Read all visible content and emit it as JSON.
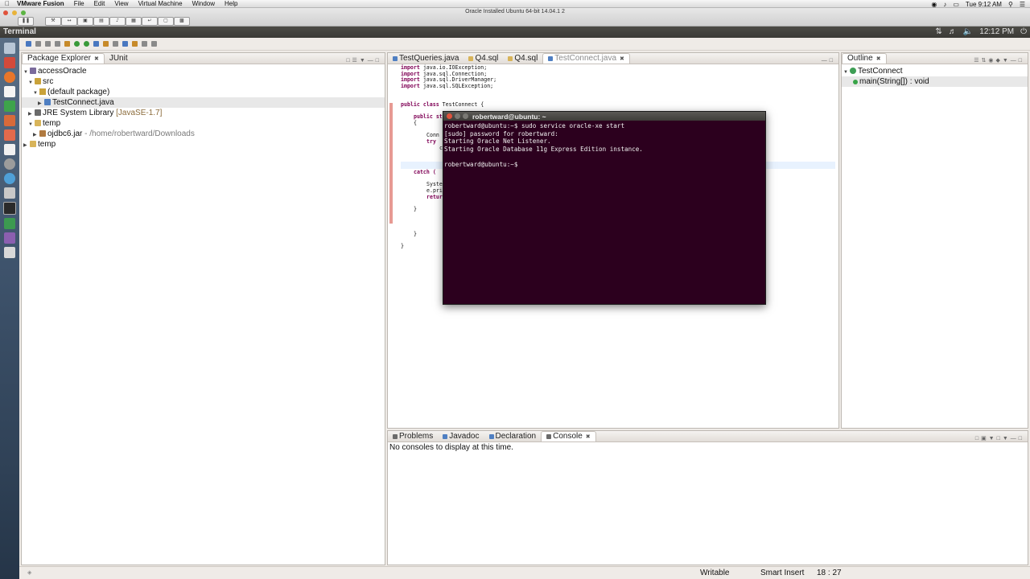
{
  "mac_menu": {
    "app": "VMware Fusion",
    "items": [
      "File",
      "Edit",
      "View",
      "Virtual Machine",
      "Window",
      "Help"
    ],
    "clock": "Tue 9:12 AM"
  },
  "vmware": {
    "window_title": "Oracle Installed Ubuntu 64-bit 14.04.1 2"
  },
  "ubuntu_panel": {
    "title": "Terminal",
    "clock": "12:12 PM"
  },
  "package_explorer": {
    "tabs": [
      {
        "label": "Package Explorer"
      },
      {
        "label": "JUnit"
      }
    ],
    "tree": [
      {
        "label": "accessOracle"
      },
      {
        "label": "src"
      },
      {
        "label": "(default package)"
      },
      {
        "label": "TestConnect.java"
      },
      {
        "label": "JRE System Library",
        "extra": "[JavaSE-1.7]"
      },
      {
        "label": "temp"
      },
      {
        "label": "ojdbc6.jar",
        "extra": "- /home/robertward/Downloads"
      },
      {
        "label": "temp"
      }
    ]
  },
  "editor": {
    "tabs": [
      {
        "label": "TestQueries.java"
      },
      {
        "label": "Q4.sql"
      },
      {
        "label": "Q4.sql"
      },
      {
        "label": "TestConnect.java"
      }
    ],
    "lines": {
      "l1": "java.io.IOException;",
      "l2": "java.sql.Connection;",
      "l3": "java.sql.DriverManager;",
      "l4": "java.sql.SQLException;",
      "l6": "TestConnect {",
      "l7": "st",
      "l8": "{",
      "l9": "Conn",
      "l10": "try",
      "l11": "c",
      "l12": "catch (",
      "l13": "Syste",
      "l14": "e.pri",
      "l15": "retur",
      "l16": "}",
      "l17": "}",
      "l18": "}"
    },
    "kw": {
      "import": "import",
      "public": "public",
      "class": "class",
      "catch": "}",
      "return": "retur"
    }
  },
  "outline": {
    "tab": "Outline",
    "items": [
      {
        "label": "TestConnect"
      },
      {
        "label": "main(String[]) : void"
      }
    ]
  },
  "console": {
    "tabs": [
      {
        "label": "Problems"
      },
      {
        "label": "Javadoc"
      },
      {
        "label": "Declaration"
      },
      {
        "label": "Console"
      }
    ],
    "message": "No consoles to display at this time."
  },
  "terminal": {
    "title": "robertward@ubuntu: ~",
    "lines": [
      "robertward@ubuntu:~$ sudo service oracle-xe start",
      "[sudo] password for robertward:",
      "Starting Oracle Net Listener.",
      "Starting Oracle Database 11g Express Edition instance.",
      "",
      "robertward@ubuntu:~$"
    ]
  },
  "status_bar": {
    "writable": "Writable",
    "insert_mode": "Smart Insert",
    "position": "18 : 27"
  },
  "colors": {
    "terminal_bg": "#2c001e",
    "keyword": "#7f0055",
    "launcher": "#3f546d"
  }
}
